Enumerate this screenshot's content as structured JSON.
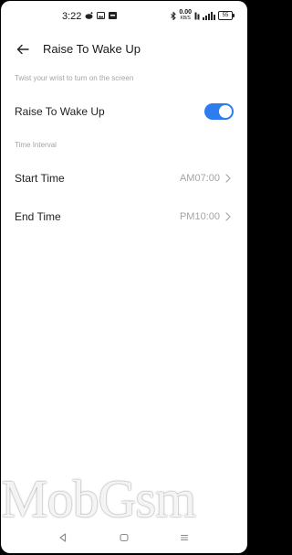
{
  "status_bar": {
    "time": "3:22",
    "net_speed_value": "0.00",
    "net_speed_unit": "KB/S",
    "battery": "55"
  },
  "header": {
    "title": "Raise To Wake Up"
  },
  "description": "Twist your wrist to turn on the screen",
  "main_toggle": {
    "label": "Raise To Wake Up",
    "enabled": true,
    "color": "#2d7cf0"
  },
  "section_label": "Time Interval",
  "rows": [
    {
      "label": "Start Time",
      "value": "AM07:00"
    },
    {
      "label": "End Time",
      "value": "PM10:00"
    }
  ],
  "watermark": "MobGsm",
  "nav_bar": {
    "items": [
      "back-triangle-icon",
      "home-square-icon",
      "recents-menu-icon"
    ]
  }
}
